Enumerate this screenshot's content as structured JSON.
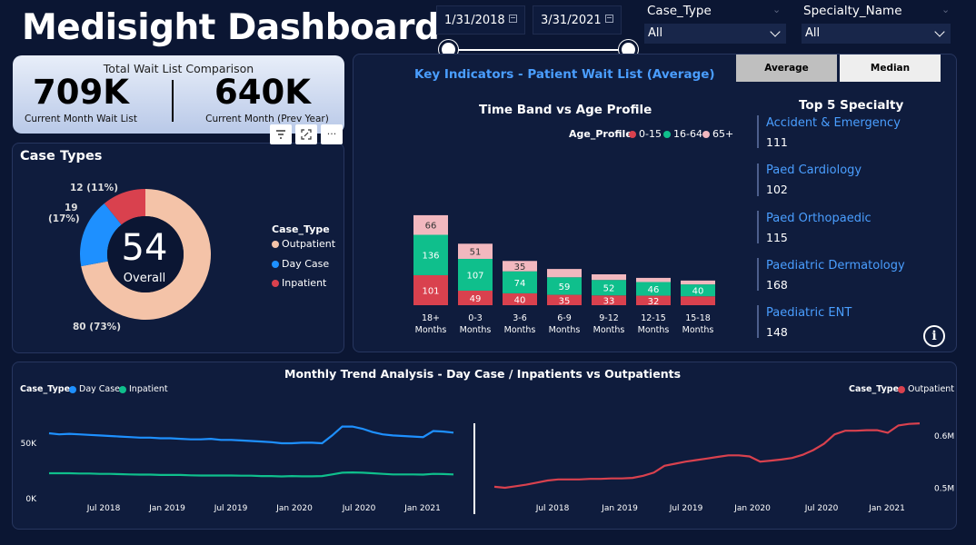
{
  "app": {
    "title": "Medisight Dashboard"
  },
  "filters": {
    "date_start": "1/31/2018",
    "date_end": "3/31/2021",
    "case_type_label": "Case_Type",
    "case_type_value": "All",
    "specialty_label": "Specialty_Name",
    "specialty_value": "All"
  },
  "kpi": {
    "title": "Total Wait List Comparison",
    "current_value": "709K",
    "current_label": "Current Month Wait List",
    "prev_value": "640K",
    "prev_label": "Current Month (Prev Year)"
  },
  "visual_header_icons": [
    "filter-icon",
    "focus-mode-icon",
    "more-options-icon"
  ],
  "more_options_glyph": "···",
  "case_types": {
    "title": "Case Types",
    "center_value": "54",
    "center_label": "Overall",
    "legend_title": "Case_Type",
    "colors": {
      "Outpatient": "#f4c3a8",
      "Day Case": "#1e90ff",
      "Inpatient": "#d9414e"
    },
    "labels": {
      "inpatient": "12 (11%)",
      "daycase_line1": "19",
      "daycase_line2": "(17%)",
      "outpatient": "80 (73%)"
    }
  },
  "key_indicators": {
    "title": "Key Indicators - Patient Wait List (Average)",
    "toggle_average": "Average",
    "toggle_median": "Median",
    "info_glyph": "i"
  },
  "time_band": {
    "title": "Time Band vs Age Profile",
    "legend_title": "Age_Profile",
    "series_names": [
      "0-15",
      "16-64",
      "65+"
    ],
    "category_lines": [
      [
        "18+",
        "Months"
      ],
      [
        "0-3",
        "Months"
      ],
      [
        "3-6",
        "Months"
      ],
      [
        "6-9",
        "Months"
      ],
      [
        "9-12",
        "Months"
      ],
      [
        "12-15",
        "Months"
      ],
      [
        "15-18",
        "Months"
      ]
    ]
  },
  "top_specialty": {
    "title": "Top 5 Specialty",
    "items": [
      {
        "name": "Accident & Emergency",
        "value": "111"
      },
      {
        "name": "Paed Cardiology",
        "value": "102"
      },
      {
        "name": "Paed Orthopaedic",
        "value": "115"
      },
      {
        "name": "Paediatric Dermatology",
        "value": "168"
      },
      {
        "name": "Paediatric ENT",
        "value": "148"
      }
    ]
  },
  "trend": {
    "title": "Monthly Trend Analysis - Day Case / Inpatients vs Outpatients",
    "left_legend_title": "Case_Type",
    "right_legend_title": "Case_Type"
  },
  "chart_data": [
    {
      "type": "pie",
      "title": "Case Types",
      "categories": [
        "Outpatient",
        "Day Case",
        "Inpatient"
      ],
      "values": [
        80,
        19,
        12
      ],
      "colors": [
        "#f4c3a8",
        "#1e90ff",
        "#d9414e"
      ]
    },
    {
      "type": "bar",
      "stacked": true,
      "title": "Time Band vs Age Profile",
      "categories": [
        "18+ Months",
        "0-3 Months",
        "3-6 Months",
        "6-9 Months",
        "9-12 Months",
        "12-15 Months",
        "15-18 Months"
      ],
      "series": [
        {
          "name": "0-15",
          "values": [
            101,
            49,
            40,
            35,
            33,
            32,
            30
          ],
          "color": "#d9414e"
        },
        {
          "name": "16-64",
          "values": [
            136,
            107,
            74,
            59,
            52,
            46,
            40
          ],
          "color": "#0fbf8c"
        },
        {
          "name": "65+",
          "values": [
            66,
            51,
            35,
            28,
            19,
            14,
            13
          ],
          "color": "#f2b8bf"
        }
      ],
      "legend": "top-right"
    },
    {
      "type": "line",
      "title": "Monthly Trend Analysis - Day Case / Inpatients vs Outpatients",
      "x": [
        "2018-01",
        "2018-02",
        "2018-03",
        "2018-04",
        "2018-05",
        "2018-06",
        "2018-07",
        "2018-08",
        "2018-09",
        "2018-10",
        "2018-11",
        "2018-12",
        "2019-01",
        "2019-02",
        "2019-03",
        "2019-04",
        "2019-05",
        "2019-06",
        "2019-07",
        "2019-08",
        "2019-09",
        "2019-10",
        "2019-11",
        "2019-12",
        "2020-01",
        "2020-02",
        "2020-03",
        "2020-04",
        "2020-05",
        "2020-06",
        "2020-07",
        "2020-08",
        "2020-09",
        "2020-10",
        "2020-11",
        "2020-12",
        "2021-01",
        "2021-02",
        "2021-03"
      ],
      "x_ticks": [
        "Jul 2018",
        "Jan 2019",
        "Jul 2019",
        "Jan 2020",
        "Jul 2020",
        "Jan 2021"
      ],
      "y_ticks": [
        "0K",
        "50K"
      ],
      "ylim": [
        0,
        80000
      ],
      "series": [
        {
          "name": "Day Case",
          "color": "#1e90ff",
          "values": [
            58000,
            57000,
            57500,
            57000,
            56500,
            56000,
            55500,
            55000,
            54500,
            54000,
            54000,
            53500,
            53500,
            53000,
            52500,
            52500,
            53000,
            52000,
            52000,
            51500,
            51000,
            50500,
            50000,
            49000,
            49000,
            49500,
            49500,
            49000,
            56000,
            64000,
            64000,
            62000,
            59000,
            57000,
            56000,
            55500,
            55000,
            54500,
            60000,
            59500,
            58500
          ],
          "values_note_skip": true
        },
        {
          "name": "Inpatient",
          "color": "#0fbf8c",
          "values": [
            22000,
            22000,
            22000,
            21800,
            21800,
            21500,
            21500,
            21200,
            21000,
            20800,
            20800,
            20500,
            20500,
            20500,
            20200,
            20000,
            20000,
            20000,
            20000,
            19800,
            19800,
            19500,
            19500,
            19200,
            19500,
            19300,
            19300,
            19500,
            21000,
            22500,
            22800,
            22500,
            22000,
            21500,
            21000,
            21000,
            21000,
            20800,
            21500,
            21300,
            21000
          ]
        }
      ],
      "legend": "top-left"
    },
    {
      "type": "line",
      "title": "Outpatient",
      "x_ticks": [
        "Jul 2018",
        "Jan 2019",
        "Jul 2019",
        "Jan 2020",
        "Jul 2020",
        "Jan 2021"
      ],
      "y_ticks": [
        "0.5M",
        "0.6M"
      ],
      "ylim": [
        0.48,
        0.65
      ],
      "series": [
        {
          "name": "Outpatient",
          "color": "#d9414e",
          "values": [
            0.501,
            0.499,
            0.502,
            0.505,
            0.509,
            0.513,
            0.515,
            0.515,
            0.515,
            0.516,
            0.516,
            0.517,
            0.517,
            0.518,
            0.522,
            0.528,
            0.541,
            0.545,
            0.549,
            0.552,
            0.555,
            0.558,
            0.561,
            0.561,
            0.559,
            0.549,
            0.551,
            0.553,
            0.556,
            0.562,
            0.571,
            0.583,
            0.601,
            0.608,
            0.608,
            0.609,
            0.609,
            0.604,
            0.618,
            0.621,
            0.622
          ]
        }
      ],
      "legend": "top-right"
    }
  ]
}
